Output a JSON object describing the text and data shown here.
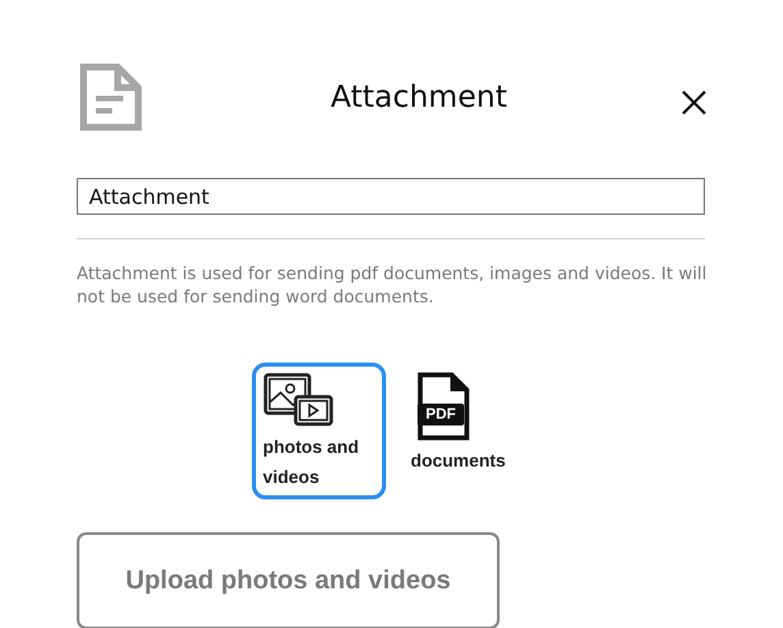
{
  "dialog": {
    "title": "Attachment"
  },
  "name_field": {
    "value": "Attachment"
  },
  "description": "Attachment is used for sending pdf documents, images and videos. It will not be used for sending word documents.",
  "options": [
    {
      "kind": "media",
      "label": "photos and videos",
      "selected": true
    },
    {
      "kind": "pdf",
      "label": "documents",
      "icon_text": "PDF",
      "selected": false
    }
  ],
  "upload_button": "Upload photos and videos"
}
